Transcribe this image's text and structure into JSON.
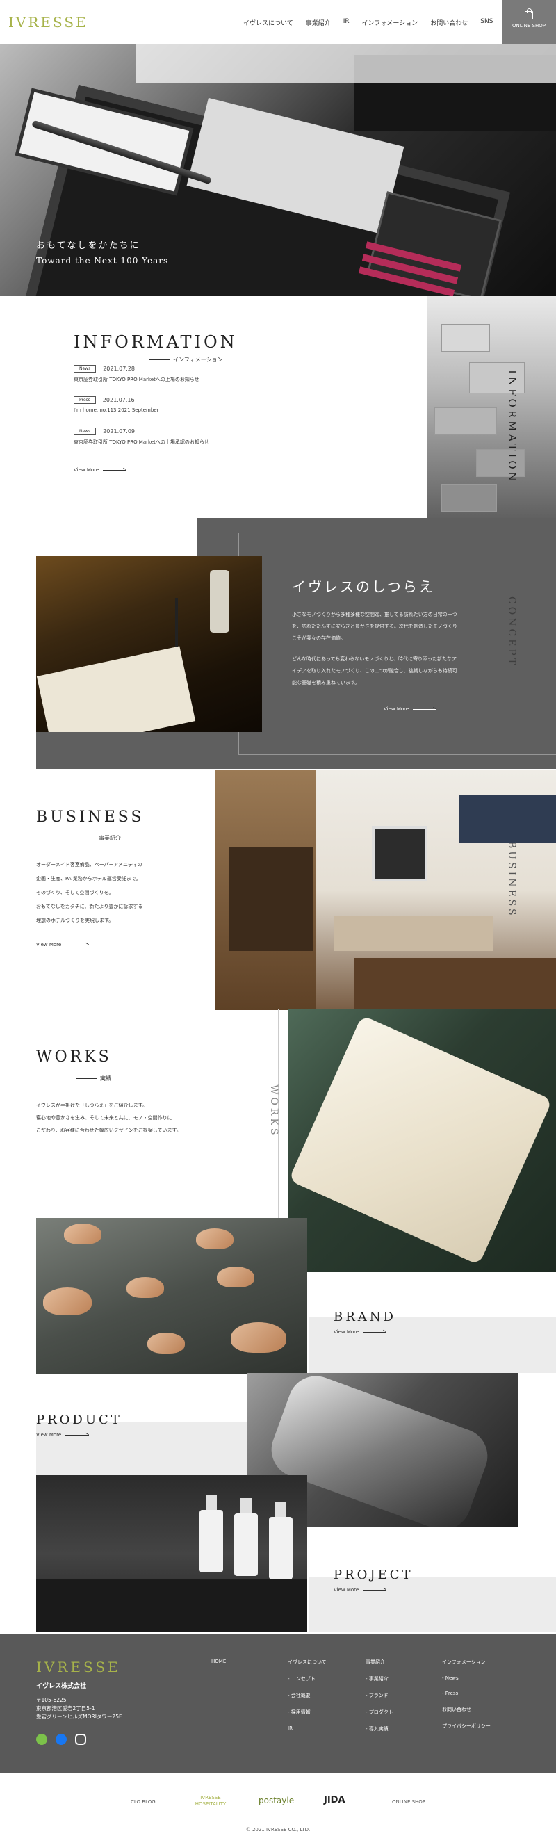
{
  "header": {
    "logo": "IVRESSE",
    "nav": [
      "イヴレスについて",
      "事業紹介",
      "IR",
      "インフォメーション",
      "お問い合わせ",
      "SNS"
    ],
    "shop_label": "ONLINE SHOP"
  },
  "hero": {
    "line1": "おもてなしをかたちに",
    "line2": "Toward the Next 100 Years"
  },
  "information": {
    "title": "INFORMATION",
    "subtitle": "インフォメーション",
    "vertical": "INFORMATION",
    "items": [
      {
        "badge": "News",
        "date": "2021.07.28",
        "text": "東京証券取引所 TOKYO PRO Marketへの上場のお知らせ"
      },
      {
        "badge": "Press",
        "date": "2021.07.16",
        "text": "I'm home. no.113 2021 September"
      },
      {
        "badge": "News",
        "date": "2021.07.09",
        "text": "東京証券取引所 TOKYO PRO Marketへの上場承認のお知らせ"
      }
    ],
    "view_more": "View More"
  },
  "concept": {
    "title": "イヴレスのしつらえ",
    "vertical": "CONCEPT",
    "p1": "小さなモノづくりから多種多様な空間迄、推してる訪れたい方の日常の一つを、訪れたたんすに安らぎと豊かさを提供する。次代を創造したモノづくりこそが我々の存在価値。",
    "p2": "どんな時代にあっても変わらないモノづくりと、時代に寄り添った新たなアイデアを取り入れたモノづくり、この二つが融合し、挑戦しながらも持続可能な基礎を積み重ねています。",
    "view_more": "View More"
  },
  "business": {
    "title": "BUSINESS",
    "subtitle": "事業紹介",
    "vertical": "BUSINESS",
    "lines": [
      "オーダーメイド客室備品、ペーパーアメニティの",
      "企画・生産、PA 業務からホテル運営受託まで。",
      "ものづくり、そして空間づくりを。",
      "おもてなしをカタチに、新たより豊かに訴求する",
      "理想のホテルづくりを実現します。"
    ],
    "view_more": "View More"
  },
  "works": {
    "title": "WORKS",
    "subtitle": "実績",
    "vertical": "WORKS",
    "lines": [
      "イヴレスが手掛けた「しつらえ」をご紹介します。",
      "寝心地や豊かさを生み、そして未来と共に、モノ・空間作りに",
      "こだわり、お客様に合わせた幅広いデザインをご提案しています。"
    ]
  },
  "brand": {
    "title": "BRAND",
    "view_more": "View More"
  },
  "product": {
    "title": "PRODUCT",
    "view_more": "View More"
  },
  "project": {
    "title": "PROJECT",
    "view_more": "View More"
  },
  "footer": {
    "logo": "IVRESSE",
    "company": "イヴレス株式会社",
    "addr": [
      "〒105-6225",
      "東京都港区愛宕2丁目5-1",
      "愛宕グリーンヒルズMORIタワー25F"
    ],
    "col_home": "HOME",
    "col1": [
      "イヴレスについて",
      "- コンセプト",
      "- 会社概要",
      "- 採用情報",
      "IR"
    ],
    "col2": [
      "事業紹介",
      "- 事業紹介",
      "- ブランド",
      "- プロダクト",
      "- 導入実績"
    ],
    "col3": [
      "インフォメーション",
      "- News",
      "- Press",
      "お問い合わせ",
      "プライバシーポリシー"
    ]
  },
  "partner_logos": [
    "CLO BLOG",
    "IVRESSE HOSPITALITY",
    "postayle",
    "JIDA",
    "ONLINE SHOP"
  ],
  "copyright": "© 2021 IVRESSE CO., LTD.",
  "colors": {
    "accent": "#a7b34a",
    "grey_panel": "#5f5f5f",
    "footer": "#595959"
  }
}
